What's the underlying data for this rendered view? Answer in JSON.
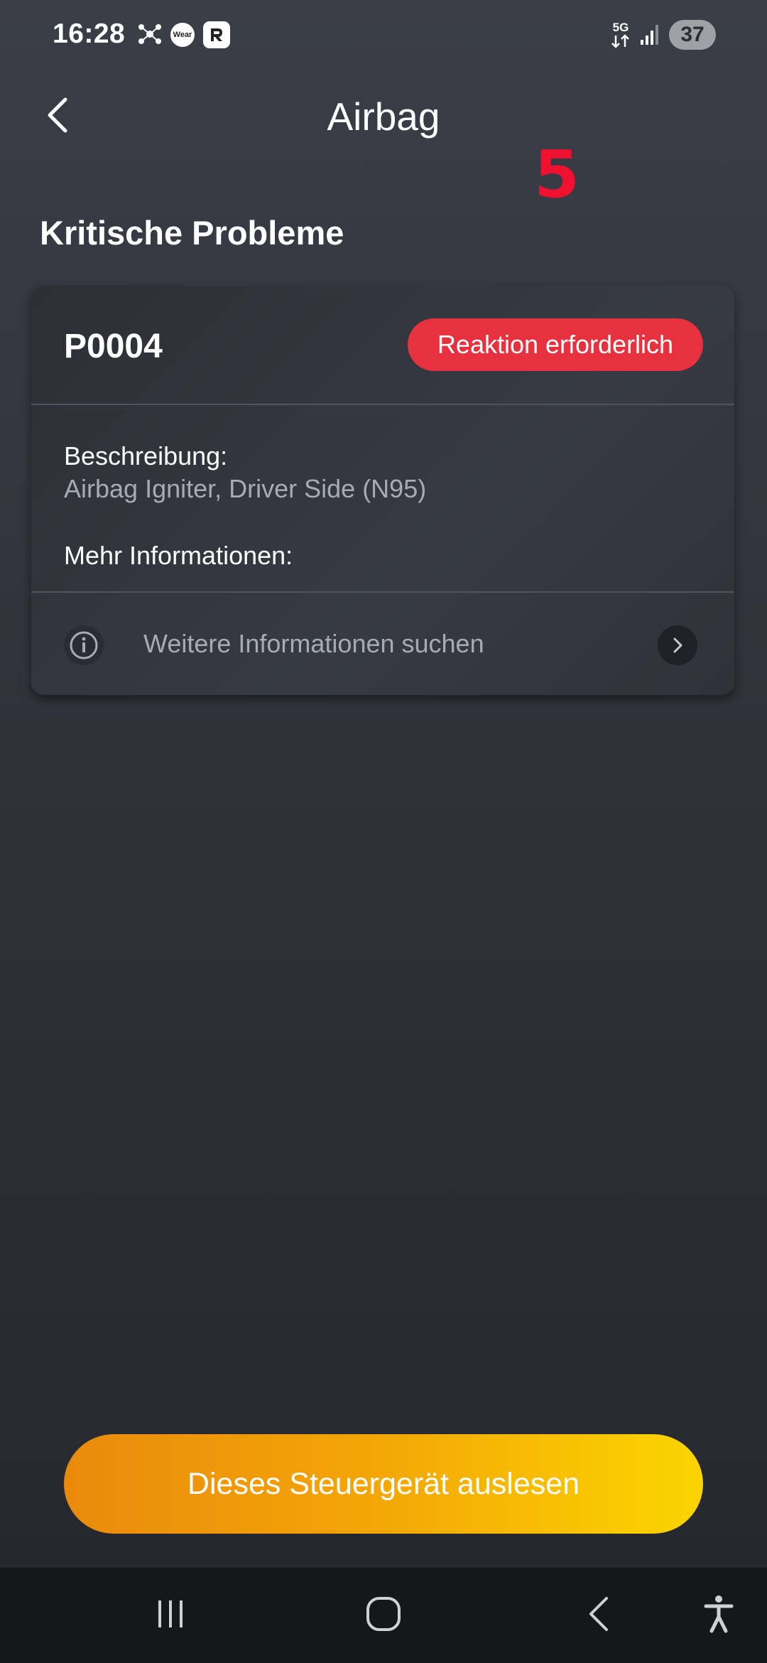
{
  "status_bar": {
    "time": "16:28",
    "wear_label": "Wear",
    "network_label": "5G",
    "battery": "37"
  },
  "header": {
    "title": "Airbag",
    "annotation": "5"
  },
  "section": {
    "title": "Kritische Probleme"
  },
  "issue": {
    "code": "P0004",
    "badge": "Reaktion erforderlich",
    "badge_color": "#e8313f",
    "description_label": "Beschreibung:",
    "description_value": "Airbag Igniter, Driver Side (N95)",
    "more_info_label": "Mehr Informationen:",
    "search_link": "Weitere Informationen suchen"
  },
  "footer": {
    "primary_button": "Dieses Steuergerät auslesen",
    "gradient_start": "#ea8a0d",
    "gradient_end": "#fbd500"
  },
  "icons": [
    "network-icon",
    "wear-icon",
    "r-app-icon",
    "5g-icon",
    "signal-icon",
    "battery-icon",
    "back-arrow-icon",
    "info-icon",
    "chevron-right-icon",
    "recents-icon",
    "home-icon",
    "nav-back-icon",
    "accessibility-icon"
  ]
}
